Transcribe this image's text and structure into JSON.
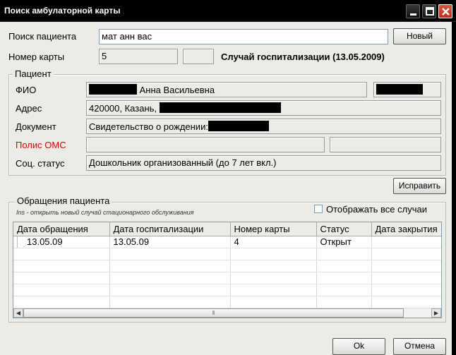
{
  "window": {
    "title": "Поиск амбулаторной карты"
  },
  "search": {
    "label": "Поиск пациента",
    "value": "мат анн вас",
    "new_button": "Новый"
  },
  "card": {
    "label": "Номер карты",
    "value": "5",
    "hospitalization_text": "Случай госпитализации (13.05.2009)"
  },
  "patient": {
    "legend": "Пациент",
    "fio_label": "ФИО",
    "fio_value": "Анна Васильевна",
    "address_label": "Адрес",
    "address_value": "420000, Казань,",
    "document_label": "Документ",
    "document_value": "Свидетельство о рождении:",
    "policy_label": "Полис ОМС",
    "social_label": "Соц. статус",
    "social_value": "Дошкольник организованный (до 7 лет вкл.)",
    "policy_color": "#e60000"
  },
  "edit_button": "Исправить",
  "appeals": {
    "legend": "Обращения пациента",
    "hint": "Ins - открыть новый случай стационарного обслуживания",
    "show_all_label": "Отображать все случаи",
    "show_all_checked": false,
    "columns": [
      "Дата обращения",
      "Дата госпитализации",
      "Номер карты",
      "Статус",
      "Дата закрытия"
    ],
    "rows": [
      {
        "appeal_date": "13.05.09",
        "hosp_date": "13.05.09",
        "card_no": "4",
        "status": "Открыт",
        "close_date": ""
      }
    ]
  },
  "footer": {
    "ok_button": "Ok",
    "cancel_button": "Отмена"
  },
  "icons": {
    "minimize": "minimize-icon",
    "maximize": "maximize-icon",
    "close": "close-icon",
    "scroll_left": "arrow-left-icon",
    "scroll_right": "arrow-right-icon",
    "scroll_grip": "grip-icon"
  }
}
